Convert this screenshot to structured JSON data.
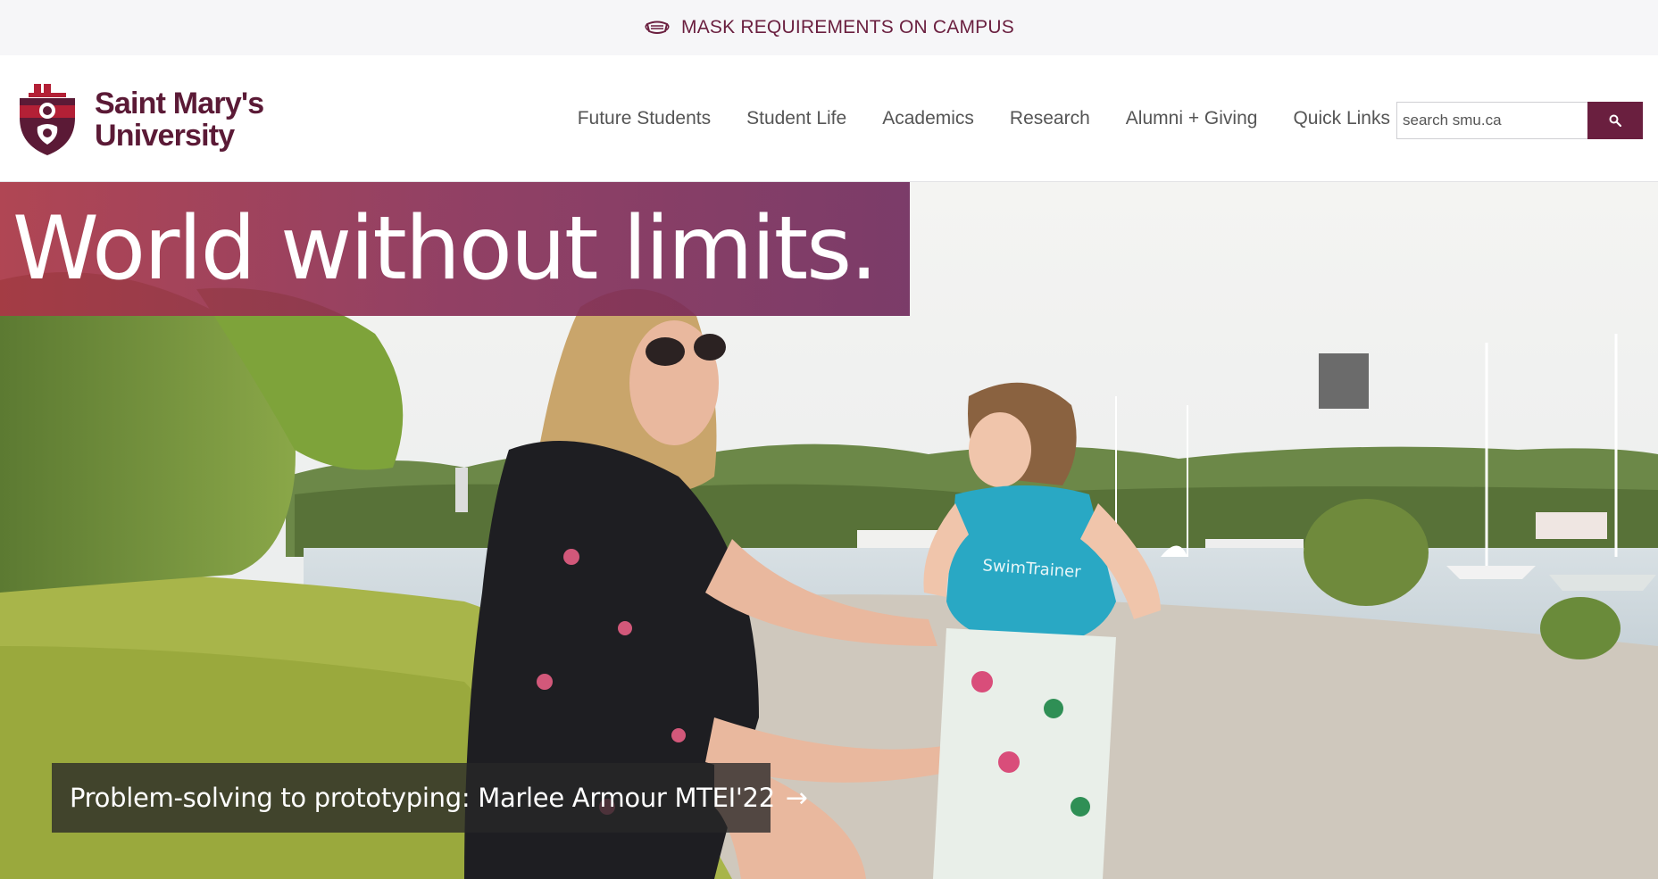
{
  "alert": {
    "text": "MASK REQUIREMENTS ON CAMPUS",
    "icon": "face-mask-icon"
  },
  "header": {
    "logo_line1": "Saint Mary's",
    "logo_line2": "University",
    "nav": [
      {
        "label": "Future Students"
      },
      {
        "label": "Student Life"
      },
      {
        "label": "Academics"
      },
      {
        "label": "Research"
      },
      {
        "label": "Alumni + Giving"
      },
      {
        "label": "Quick Links"
      }
    ],
    "search": {
      "placeholder": "search smu.ca",
      "button_icon": "search-icon"
    }
  },
  "hero": {
    "title": "World without limits.",
    "story_link": "Problem-solving to prototyping: Marlee Armour MTEI'22",
    "story_icon": "arrow-right-icon",
    "vest_text": "SwimTrainer"
  },
  "colors": {
    "brand": "#6a1f3f",
    "alert_bg": "#f6f6f8",
    "nav_text": "#555555"
  }
}
